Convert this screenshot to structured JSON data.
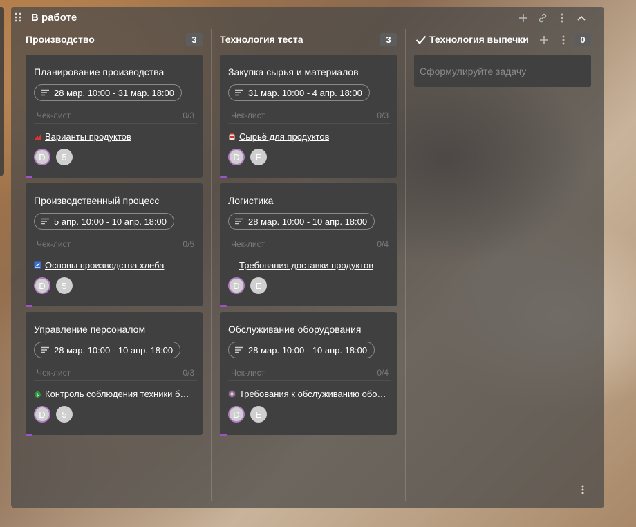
{
  "board": {
    "title": "В работе",
    "icons": [
      "drag-handle-icon",
      "plus-icon",
      "link-icon",
      "more-vert-icon",
      "chevron-up-icon"
    ]
  },
  "columns": [
    {
      "title": "Производство",
      "count": "3",
      "cards": [
        {
          "title": "Планирование производства",
          "dates": "28 мар. 10:00 - 31 мар. 18:00",
          "checklist_label": "Чек-лист",
          "checklist_count": "0/3",
          "link": "Варианты продуктов",
          "link_icon": "chart-icon",
          "avatars": [
            "D",
            "5"
          ]
        },
        {
          "title": "Производственный процесс",
          "dates": "5 апр. 10:00 - 10 апр. 18:00",
          "checklist_label": "Чек-лист",
          "checklist_count": "0/5",
          "link": "Основы производства хлеба",
          "link_icon": "document-icon",
          "avatars": [
            "D",
            "5"
          ]
        },
        {
          "title": "Управление персоналом",
          "dates": "28 мар. 10:00 - 10 апр. 18:00",
          "checklist_label": "Чек-лист",
          "checklist_count": "0/3",
          "link": "Контроль соблюдения техники б…",
          "link_icon": "money-bag-icon",
          "avatars": [
            "D",
            "5"
          ]
        }
      ]
    },
    {
      "title": "Технология теста",
      "count": "3",
      "cards": [
        {
          "title": "Закупка сырья и материалов",
          "dates": "31 мар. 10:00 - 4 апр. 18:00",
          "checklist_label": "Чек-лист",
          "checklist_count": "0/3",
          "link": "Сырьё для продуктов",
          "link_icon": "jar-icon",
          "avatars": [
            "D",
            "E"
          ]
        },
        {
          "title": "Логистика",
          "dates": "28 мар. 10:00 - 10 апр. 18:00",
          "checklist_label": "Чек-лист",
          "checklist_count": "0/4",
          "link": "Требования доставки продуктов",
          "link_icon": "",
          "avatars": [
            "D",
            "E"
          ]
        },
        {
          "title": "Обслуживание оборудования",
          "dates": "28 мар. 10:00 - 10 апр. 18:00",
          "checklist_label": "Чек-лист",
          "checklist_count": "0/4",
          "link": "Требования к обслуживанию обо…",
          "link_icon": "gear-face-icon",
          "avatars": [
            "D",
            "E"
          ]
        }
      ]
    },
    {
      "title": "Технология выпечки",
      "count": "0",
      "new_task_placeholder": "Сформулируйте задачу"
    }
  ],
  "colors": {
    "card_bg": "#404040",
    "board_bg": "rgba(72,72,72,0.72)",
    "accent": "#a050c8",
    "badge_bg": "#5d5d5d"
  }
}
